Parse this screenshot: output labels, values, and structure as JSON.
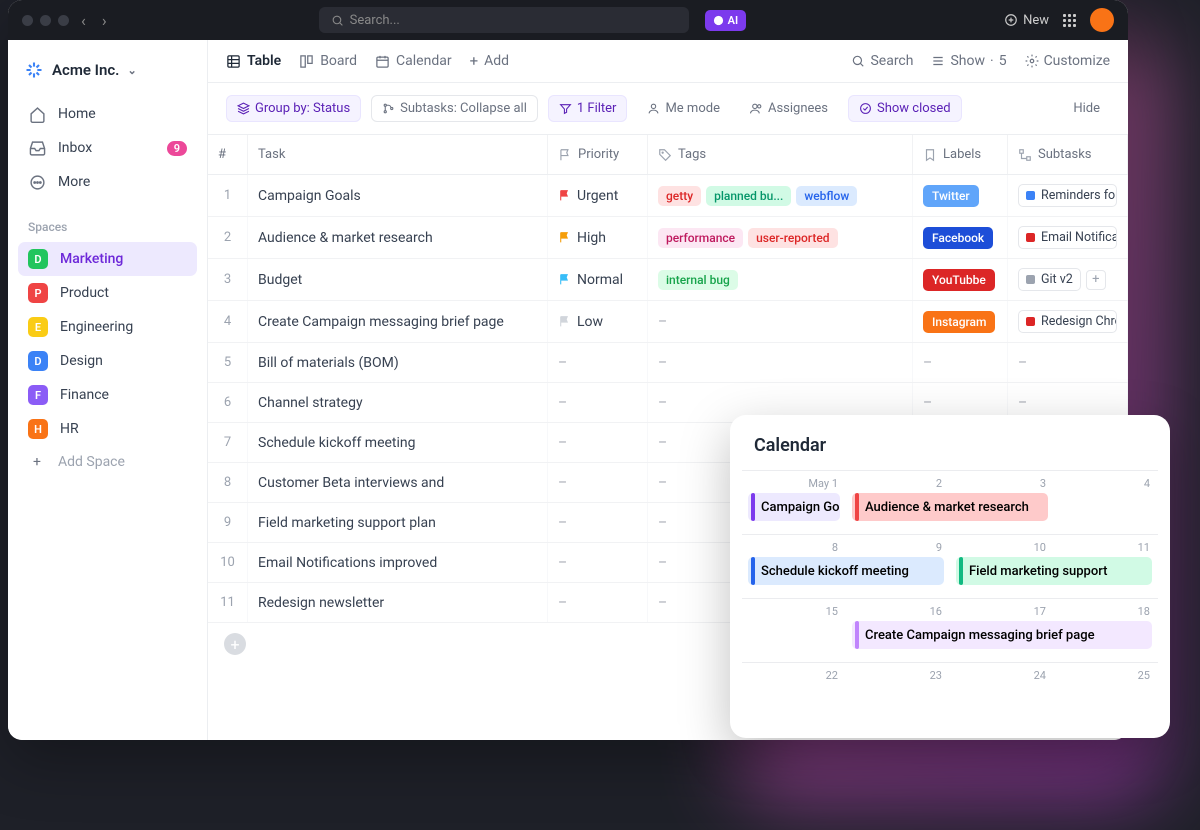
{
  "chrome": {
    "search_placeholder": "Search...",
    "ai_label": "AI",
    "new_label": "New"
  },
  "workspace": {
    "name": "Acme Inc."
  },
  "nav": {
    "home": "Home",
    "inbox": "Inbox",
    "inbox_badge": "9",
    "more": "More"
  },
  "spaces_header": "Spaces",
  "spaces": [
    {
      "letter": "D",
      "label": "Marketing",
      "color": "#22c55e",
      "active": true
    },
    {
      "letter": "P",
      "label": "Product",
      "color": "#ef4444"
    },
    {
      "letter": "E",
      "label": "Engineering",
      "color": "#facc15"
    },
    {
      "letter": "D",
      "label": "Design",
      "color": "#3b82f6"
    },
    {
      "letter": "F",
      "label": "Finance",
      "color": "#8b5cf6"
    },
    {
      "letter": "H",
      "label": "HR",
      "color": "#f97316"
    }
  ],
  "add_space": "Add Space",
  "tabs": {
    "table": "Table",
    "board": "Board",
    "calendar": "Calendar",
    "add": "Add",
    "search": "Search",
    "show": "Show",
    "show_num": "5",
    "customize": "Customize"
  },
  "filters": {
    "group": "Group by: Status",
    "subtasks": "Subtasks: Collapse all",
    "filter": "1 Filter",
    "me": "Me mode",
    "assignees": "Assignees",
    "closed": "Show closed",
    "hide": "Hide"
  },
  "columns": {
    "num": "#",
    "task": "Task",
    "priority": "Priority",
    "tags": "Tags",
    "labels": "Labels",
    "subtasks": "Subtasks"
  },
  "rows": [
    {
      "n": "1",
      "task": "Campaign Goals",
      "priority": {
        "text": "Urgent",
        "color": "#ef4444"
      },
      "tags": [
        {
          "text": "getty",
          "bg": "#fee2e2",
          "fg": "#dc2626"
        },
        {
          "text": "planned bu...",
          "bg": "#d1fae5",
          "fg": "#059669"
        },
        {
          "text": "webflow",
          "bg": "#dbeafe",
          "fg": "#2563eb"
        }
      ],
      "label": {
        "text": "Twitter",
        "bg": "#60a5fa"
      },
      "subtask": {
        "text": "Reminders for",
        "color": "#3b82f6"
      }
    },
    {
      "n": "2",
      "task": "Audience & market research",
      "priority": {
        "text": "High",
        "color": "#f59e0b"
      },
      "tags": [
        {
          "text": "performance",
          "bg": "#fce7f3",
          "fg": "#be185d"
        },
        {
          "text": "user-reported",
          "bg": "#fee2e2",
          "fg": "#dc2626"
        }
      ],
      "label": {
        "text": "Facebook",
        "bg": "#1d4ed8"
      },
      "subtask": {
        "text": "Email Notificat",
        "color": "#dc2626"
      }
    },
    {
      "n": "3",
      "task": "Budget",
      "priority": {
        "text": "Normal",
        "color": "#38bdf8"
      },
      "tags": [
        {
          "text": "internal bug",
          "bg": "#dcfce7",
          "fg": "#16a34a"
        }
      ],
      "label": {
        "text": "YouTubbe",
        "bg": "#dc2626"
      },
      "subtask": {
        "text": "Git v2",
        "color": "#9ca3af",
        "plus": true
      }
    },
    {
      "n": "4",
      "task": "Create Campaign messaging brief page",
      "priority": {
        "text": "Low",
        "color": "#d1d5db"
      },
      "tags": [],
      "label": {
        "text": "Instagram",
        "bg": "#f97316"
      },
      "subtask": {
        "text": "Redesign Chro",
        "color": "#dc2626"
      }
    },
    {
      "n": "5",
      "task": "Bill of materials (BOM)"
    },
    {
      "n": "6",
      "task": "Channel strategy"
    },
    {
      "n": "7",
      "task": "Schedule kickoff meeting"
    },
    {
      "n": "8",
      "task": "Customer Beta interviews and"
    },
    {
      "n": "9",
      "task": "Field marketing support plan"
    },
    {
      "n": "10",
      "task": "Email Notifications improved"
    },
    {
      "n": "11",
      "task": "Redesign newsletter"
    }
  ],
  "calendar": {
    "title": "Calendar",
    "dates": [
      "May 1",
      "2",
      "3",
      "4",
      "8",
      "9",
      "10",
      "11",
      "15",
      "16",
      "17",
      "18",
      "22",
      "23",
      "24",
      "25"
    ],
    "events": [
      {
        "row": 0,
        "col": 0,
        "span": 1,
        "text": "Campaign Goals",
        "bg": "#ede9fe",
        "bar": "#7c3aed"
      },
      {
        "row": 0,
        "col": 1,
        "span": 2,
        "text": "Audience & market research",
        "bg": "#fecaca",
        "bar": "#ef4444"
      },
      {
        "row": 1,
        "col": 0,
        "span": 2,
        "text": "Schedule kickoff meeting",
        "bg": "#dbeafe",
        "bar": "#2563eb"
      },
      {
        "row": 1,
        "col": 2,
        "span": 2,
        "text": "Field marketing support",
        "bg": "#d1fae5",
        "bar": "#10b981"
      },
      {
        "row": 2,
        "col": 1,
        "span": 3,
        "text": "Create Campaign messaging brief page",
        "bg": "#f3e8ff",
        "bar": "#c084fc"
      }
    ]
  }
}
